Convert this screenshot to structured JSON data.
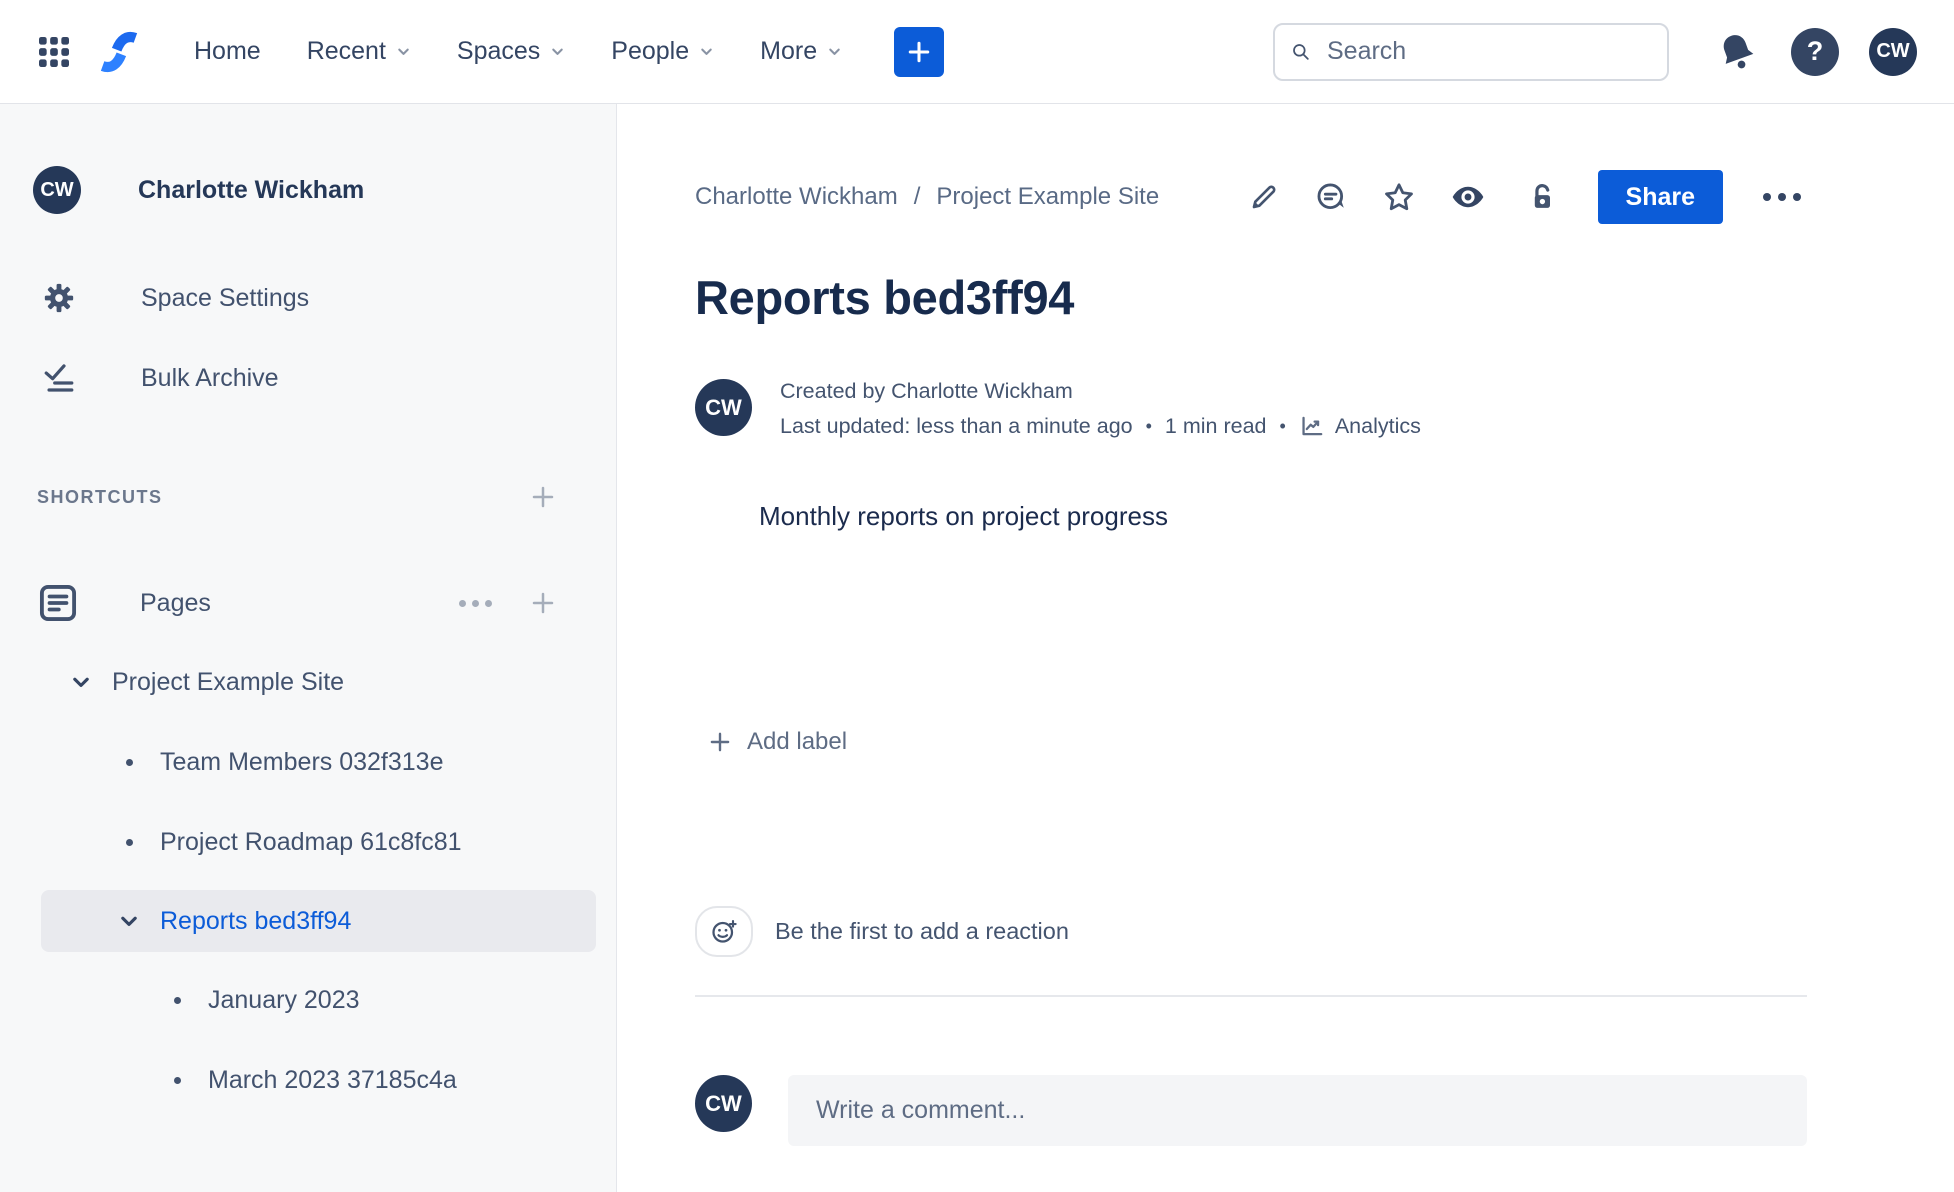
{
  "topbar": {
    "nav": [
      {
        "label": "Home"
      },
      {
        "label": "Recent"
      },
      {
        "label": "Spaces"
      },
      {
        "label": "People"
      },
      {
        "label": "More"
      }
    ],
    "search": {
      "placeholder": "Search"
    },
    "avatar_initials": "CW"
  },
  "icons": {
    "help_glyph": "?"
  },
  "sidebar": {
    "profile": {
      "initials": "CW",
      "name": "Charlotte Wickham"
    },
    "menu": [
      {
        "label": "Space Settings",
        "icon": "gear-icon"
      },
      {
        "label": "Bulk Archive",
        "icon": "bulk-archive-icon"
      }
    ],
    "shortcuts_label": "SHORTCUTS",
    "pages_label": "Pages",
    "tree": [
      {
        "label": "Project Example Site",
        "level": 0,
        "marker": "chevron-down",
        "selected": false
      },
      {
        "label": "Team Members 032f313e",
        "level": 1,
        "marker": "bullet",
        "selected": false
      },
      {
        "label": "Project Roadmap 61c8fc81",
        "level": 1,
        "marker": "bullet",
        "selected": false
      },
      {
        "label": "Reports bed3ff94",
        "level": 1,
        "marker": "chevron-down",
        "selected": true
      },
      {
        "label": "January 2023",
        "level": 2,
        "marker": "bullet",
        "selected": false
      },
      {
        "label": "March 2023 37185c4a",
        "level": 2,
        "marker": "bullet",
        "selected": false
      }
    ]
  },
  "content": {
    "breadcrumb": {
      "items": [
        "Charlotte Wickham",
        "Project Example Site"
      ],
      "separator": "/"
    },
    "actions": {
      "share_label": "Share"
    },
    "title": "Reports bed3ff94",
    "byline": {
      "initials": "CW",
      "created": "Created by Charlotte Wickham",
      "updated": "Last updated: less than a minute ago",
      "separator": "•",
      "read_time": "1 min read",
      "analytics_label": "Analytics"
    },
    "body_text": "Monthly reports on project progress",
    "labels": {
      "add_label": "Add label"
    },
    "reactions": {
      "prompt": "Be the first to add a reaction"
    },
    "comment": {
      "placeholder": "Write a comment...",
      "initials": "CW"
    }
  },
  "colors": {
    "brand_blue": "#0C5CD8",
    "navy_text": "#172B4D",
    "slate_text": "#44546F",
    "gray_text": "#6B778C",
    "sidebar_bg": "#F7F8F9",
    "selected_row_bg": "#E9EAEE",
    "comment_box_bg": "#F4F5F7"
  }
}
